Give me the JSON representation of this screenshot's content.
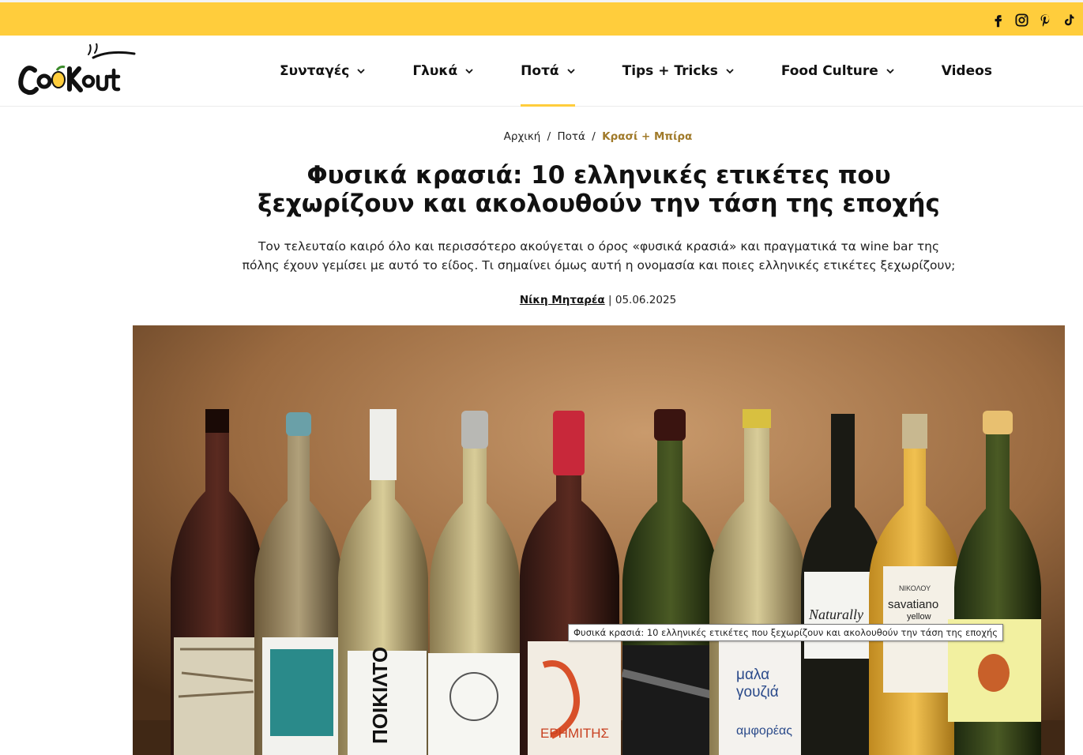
{
  "social": {
    "icons": [
      "facebook-icon",
      "instagram-icon",
      "pinterest-icon",
      "tiktok-icon"
    ]
  },
  "logo": {
    "text": "CooKout",
    "alt": "Cookout"
  },
  "nav": {
    "items": [
      {
        "label": "Συνταγές",
        "has_dropdown": true
      },
      {
        "label": "Γλυκά",
        "has_dropdown": true
      },
      {
        "label": "Ποτά",
        "has_dropdown": true,
        "active": true
      },
      {
        "label": "Tips + Tricks",
        "has_dropdown": true
      },
      {
        "label": "Food Culture",
        "has_dropdown": true
      },
      {
        "label": "Videos",
        "has_dropdown": false
      }
    ]
  },
  "breadcrumb": {
    "home": "Αρχική",
    "category": "Ποτά",
    "current": "Κρασί + Μπίρα",
    "separator": "/"
  },
  "article": {
    "title_line1": "Φυσικά κρασιά: 10 ελληνικές ετικέτες που",
    "title_line2": "ξεχωρίζουν και ακολουθούν την τάση της εποχής",
    "lead_line1": "Τον τελευταίο καιρό όλο και περισσότερο ακούγεται ο όρος «φυσικά κρασιά» και πραγματικά τα wine bar της",
    "lead_line2": "πόλης έχουν γεμίσει με αυτό το είδος. Τι σημαίνει όμως αυτή η ονομασία και ποιες ελληνικές ετικέτες ξεχωρίζουν;",
    "author": "Νίκη Μηταρέα",
    "byline_separator": "|",
    "date": "05.06.2025"
  },
  "hero": {
    "tooltip": "Φυσικά κρασιά: 10 ελληνικές ετικέτες που ξεχωρίζουν και ακολουθούν την τάση της εποχής",
    "label_texts": {
      "b3": "ΠΟΙΚΙΛΤΟ",
      "b6": "ΕΡΗΜΙΤΗΣ",
      "b8_line1": "μαλα",
      "b8_line2": "γουζιά",
      "b8_line3": "αμφορέας",
      "b9": "Naturally",
      "b10_brand": "ΝΙΚΟΛΟΥ",
      "b10_line1": "savatiano",
      "b10_line2": "yellow"
    }
  },
  "colors": {
    "accent_yellow": "#ffcd3c",
    "breadcrumb_current": "#a07a2a",
    "text": "#111111"
  }
}
